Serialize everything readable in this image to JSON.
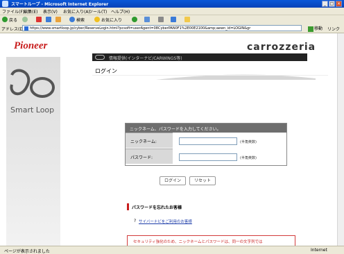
{
  "window": {
    "title": "スマートループ - Microsoft Internet Explorer"
  },
  "menu": [
    "ファイル(F)",
    "編集(E)",
    "表示(V)",
    "お気に入り(A)",
    "ツール(T)",
    "ヘルプ(H)"
  ],
  "toolbar": {
    "back_label": "戻る",
    "search_label": "検索",
    "favorites_label": "お気に入り"
  },
  "address": {
    "label": "アドレス(D)",
    "url": "https://www.smartloop.jp/cyber/ReserveLogin.html?pcsoft=userAgent=08CyberPAN0F1%2E00E2100&amp;aewn_id=LOGIN&gr",
    "go_label": "移動",
    "links_label": "リンク"
  },
  "page": {
    "pioneer_logo": "Pioneer",
    "carrozzeria_logo": "carrozzeria",
    "smartloop_text": "Smart Loop",
    "banner_text": "情報提供(インターナビ/CARWINGS等)",
    "login_heading": "ログイン",
    "login_box": {
      "instruction": "ニックネーム、パスワードを入力してください。",
      "nickname_label": "ニックネーム:",
      "nickname_value": "",
      "nickname_note": "(半角英数)",
      "password_label": "パスワード:",
      "password_value": "",
      "password_note": "(半角英数)"
    },
    "login_button": "ログイン",
    "reset_button": "リセット",
    "forgot_heading": "パスワードを忘れたお客様",
    "help_question_mark": "?",
    "help_link": "サイバーナビをご利用のお客様",
    "security_notice": "セキュリティ強化のため、ニックネームとパスワードは、同一の文字列では"
  },
  "status": {
    "text": "ページが表示されました",
    "zone": "Internet"
  },
  "colors": {
    "brand_red": "#c81e1e",
    "titlebar_blue": "#0a58d8",
    "header_gray": "#6e6e6e"
  }
}
